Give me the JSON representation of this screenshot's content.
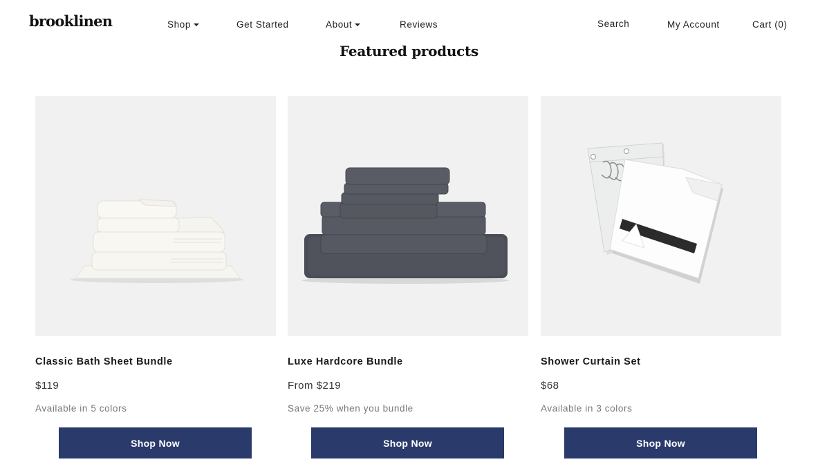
{
  "header": {
    "logo": "brooklinen",
    "nav": [
      {
        "label": "Shop",
        "dropdown": true
      },
      {
        "label": "Get Started",
        "dropdown": false
      },
      {
        "label": "About",
        "dropdown": true
      },
      {
        "label": "Reviews",
        "dropdown": false
      }
    ],
    "search_label": "Search",
    "account_label": "My Account",
    "cart_label": "Cart (0)"
  },
  "section": {
    "title": "Featured products"
  },
  "products": [
    {
      "name": "Classic Bath Sheet Bundle",
      "price": "$119",
      "note": "Available in 5 colors",
      "button": "Shop Now",
      "image": "white-towel-stack"
    },
    {
      "name": "Luxe Hardcore Bundle",
      "price": "From $219",
      "note": "Save 25% when you bundle",
      "button": "Shop Now",
      "image": "charcoal-sheet-stack"
    },
    {
      "name": "Shower Curtain Set",
      "price": "$68",
      "note": "Available in 3 colors",
      "button": "Shop Now",
      "image": "shower-curtain-package"
    }
  ],
  "colors": {
    "button_bg": "#2a3a6b",
    "image_bg": "#f1f1f1",
    "sheet_color": "#4a4d55"
  }
}
